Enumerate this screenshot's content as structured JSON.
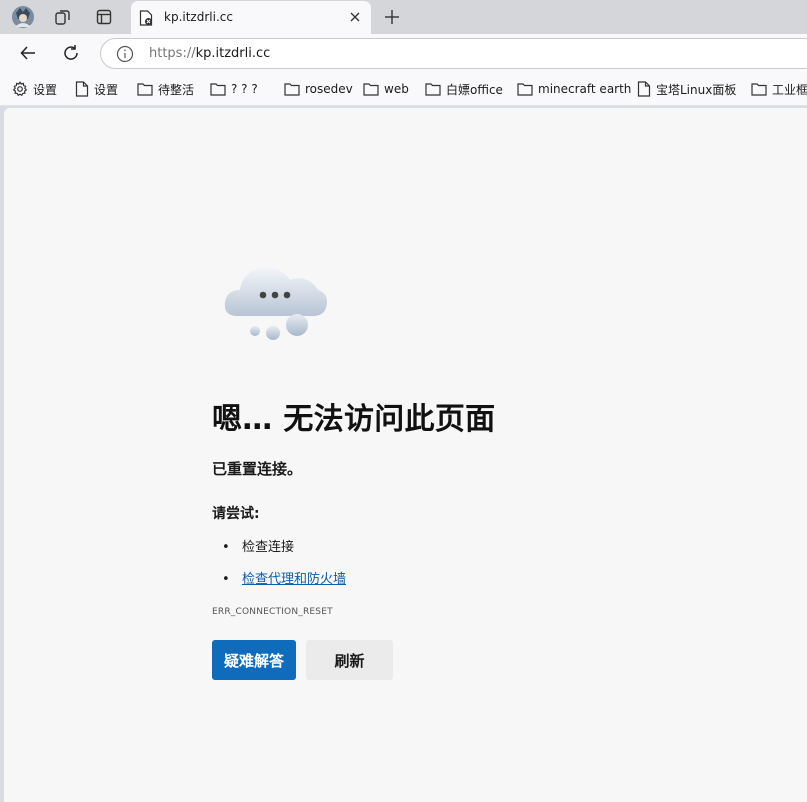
{
  "tabs": [
    {
      "title": "kp.itzdrli.cc",
      "active": true
    }
  ],
  "address_bar": {
    "url_scheme": "https://",
    "url_host": "kp.itzdrli.cc"
  },
  "bookmarks": [
    {
      "label": "设置",
      "icon": "gear-icon"
    },
    {
      "label": "设置",
      "icon": "page-icon"
    },
    {
      "label": "待整活",
      "icon": "folder-icon"
    },
    {
      "label": "? ? ?",
      "icon": "folder-icon"
    },
    {
      "label": "rosedev",
      "icon": "folder-icon"
    },
    {
      "label": "web",
      "icon": "folder-icon"
    },
    {
      "label": "白嫖office",
      "icon": "folder-icon"
    },
    {
      "label": "minecraft earth",
      "icon": "folder-icon"
    },
    {
      "label": "宝塔Linux面板",
      "icon": "page-icon"
    },
    {
      "label": "工业框",
      "icon": "folder-icon"
    }
  ],
  "error_page": {
    "title": "嗯… 无法访问此页面",
    "subtitle": "已重置连接。",
    "try_label": "请尝试:",
    "suggestions": [
      {
        "text": "检查连接",
        "link": false
      },
      {
        "text": "检查代理和防火墙",
        "link": true
      }
    ],
    "error_code": "ERR_CONNECTION_RESET",
    "primary_button": "疑难解答",
    "secondary_button": "刷新"
  },
  "colors": {
    "primary_button": "#0f6cbd",
    "link": "#0f5ca8",
    "page_background": "#f7f7f7"
  }
}
